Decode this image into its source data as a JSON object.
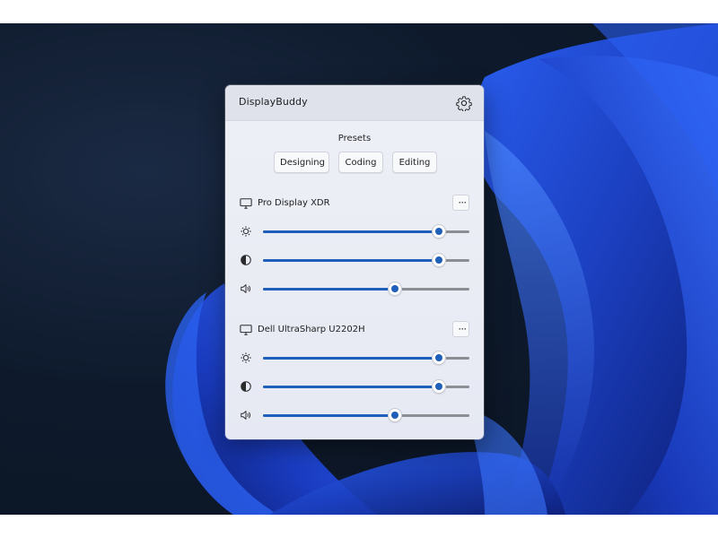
{
  "app": {
    "title": "DisplayBuddy",
    "settings_icon": "gear-icon"
  },
  "presets": {
    "label": "Presets",
    "buttons": [
      "Designing",
      "Coding",
      "Editing"
    ]
  },
  "monitors": [
    {
      "name": "Pro Display XDR",
      "more_label": "···",
      "brightness": 0.85,
      "contrast": 0.85,
      "volume": 0.64
    },
    {
      "name": "Dell UltraSharp U2202H",
      "more_label": "···",
      "brightness": 0.85,
      "contrast": 0.85,
      "volume": 0.64
    }
  ],
  "colors": {
    "accent": "#1f5fb9",
    "track": "#8c8e93",
    "panel": "#eef0f6",
    "wallpaper_bg": "#0e1a2c",
    "wallpaper_bloom": "#1f4fd6"
  }
}
